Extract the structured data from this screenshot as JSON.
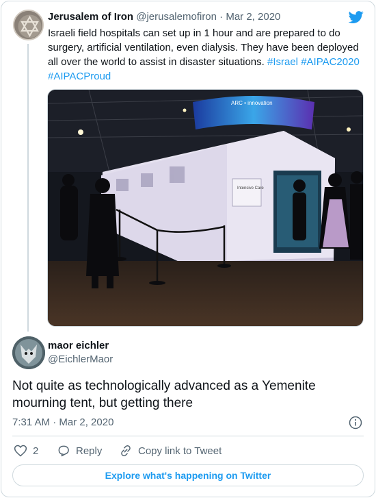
{
  "quoted_tweet": {
    "author_name": "Jerusalem of Iron",
    "author_handle": "@jerusalemofiron",
    "date": "Mar 2, 2020",
    "text": "Israeli field hospitals can set up in 1 hour and are prepared to do surgery, artificial ventilation, even dialysis. They have been deployed all over the world to assist in disaster situations. ",
    "hashtags": [
      "#Israel",
      "#AIPAC2020",
      "#AIPACProud"
    ]
  },
  "reply_tweet": {
    "author_name": "maor eichler",
    "author_handle": "@EichlerMaor",
    "text": "Not quite as technologically advanced as a Yemenite mourning tent, but getting there",
    "time": "7:31 AM · Mar 2, 2020"
  },
  "actions": {
    "like_count": "2",
    "reply_label": "Reply",
    "copy_label": "Copy link to Tweet"
  },
  "explore_label": "Explore what's happening on Twitter",
  "photo": {
    "screen_text": "ARC • innovation",
    "sign_text": "Intensive Care"
  },
  "colors": {
    "accent": "#1d9bf0",
    "secondary_text": "#536471",
    "border": "#cfd9de"
  },
  "icons": [
    "star-of-david-avatar",
    "twitter-bird-icon",
    "wolf-avatar",
    "info-icon",
    "heart-icon",
    "reply-icon",
    "link-icon"
  ]
}
